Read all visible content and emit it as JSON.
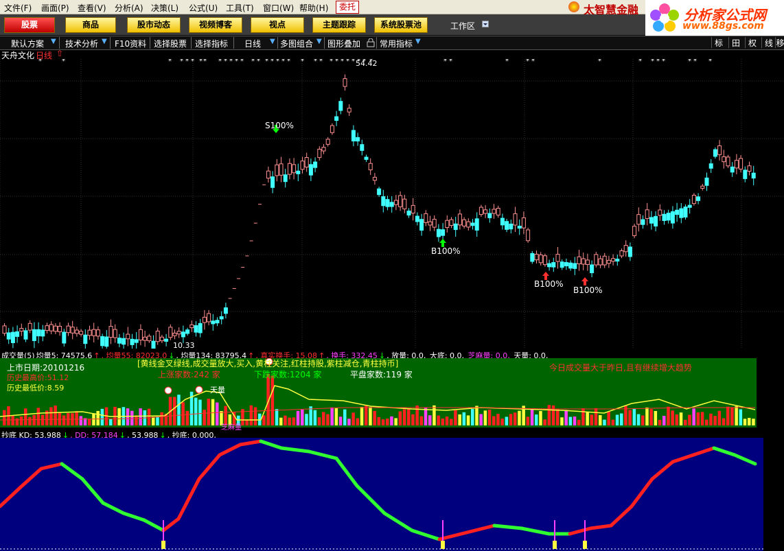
{
  "menu": {
    "items": [
      "文件(F)",
      "画面(P)",
      "查看(V)",
      "分析(A)",
      "决策(L)",
      "公式(U)",
      "工具(T)",
      "窗口(W)",
      "帮助(H)"
    ],
    "entrust": "委托"
  },
  "brand": {
    "name": "太智慧金融"
  },
  "site": {
    "title": "分析家公式网",
    "url": "www.88gs.com"
  },
  "tabs": [
    "股票",
    "商品",
    "股市动态",
    "视频博客",
    "视点",
    "主题跟踪",
    "系统股票池"
  ],
  "workzone": "工作区",
  "toolbar": {
    "items": [
      "默认方案",
      "技术分析",
      "F10资料",
      "选择股票",
      "选择指标",
      "日线",
      "多图组合",
      "图形叠加",
      "常用指标"
    ],
    "right": [
      "标",
      "田",
      "权",
      "线",
      "移"
    ]
  },
  "stock": {
    "name": "天舟文化",
    "period": "日线",
    "arrow": "⇧"
  },
  "chart_labels": {
    "s100": "S100%",
    "b100a": "B100%",
    "b100b": "B100%",
    "b100c": "B100%",
    "low": "10.33",
    "high": "54.42",
    "n1": "1",
    "n2": "2"
  },
  "volume_header": [
    {
      "t": "成交量(5)",
      "c": "#ffffff"
    },
    {
      "t": "均量5: 74575.6",
      "c": "#ffffff"
    },
    {
      "t": "↑",
      "c": "#ff3030"
    },
    {
      "t": ", 均量55: 82023.0",
      "c": "#ff3030"
    },
    {
      "t": "↓",
      "c": "#00ff00"
    },
    {
      "t": ", 均量134: 83795.4",
      "c": "#ffffff"
    },
    {
      "t": "↑",
      "c": "#ff3030"
    },
    {
      "t": ", 真实换手: 15.08",
      "c": "#ff3030"
    },
    {
      "t": "↑",
      "c": "#ff3030"
    },
    {
      "t": ", 换手: 332.45",
      "c": "#ff40ff"
    },
    {
      "t": "↓",
      "c": "#00ff00"
    },
    {
      "t": ", 放量: 0.0,",
      "c": "#ffffff"
    },
    {
      "t": " 大底: 0.0,",
      "c": "#ffffff"
    },
    {
      "t": " 芝麻量: 0.0,",
      "c": "#ff40ff"
    },
    {
      "t": " 天量: 0.0,",
      "c": "#ffffff"
    }
  ],
  "volume_panel": {
    "listing_label": "上市日期:20101216",
    "hist_high": "历史最高价:51.12",
    "hist_low": "历史最低价:8.59",
    "signal_text": "[黄线金叉绿线,成交量放大,买入,黄柱关注,红柱持股,紫柱减仓,青柱持币]",
    "up_count": "上涨家数:242 家",
    "down_count": "下跌家数:1204 家",
    "flat_count": "平盘家数:119 家",
    "notice": "今日成交量大于昨日,且有继续增大趋势",
    "tianliang": "天量",
    "zhima": "芝麻量"
  },
  "kd_header": [
    {
      "t": "抄底 KD: 53.988",
      "c": "#ffffff"
    },
    {
      "t": "↓",
      "c": "#00ff00"
    },
    {
      "t": ", DD: 57.184",
      "c": "#ff40ff"
    },
    {
      "t": "↓",
      "c": "#00ff00"
    },
    {
      "t": ", 53.988",
      "c": "#ffffff"
    },
    {
      "t": "↓",
      "c": "#00ff00"
    },
    {
      "t": ", 抄底: 0.000,",
      "c": "#ffffff"
    }
  ],
  "colors": {
    "up": "#ff9090",
    "down": "#40ffff",
    "panel_green": "#006400",
    "panel_blue": "#00007f",
    "accent_red": "#ff3030"
  }
}
